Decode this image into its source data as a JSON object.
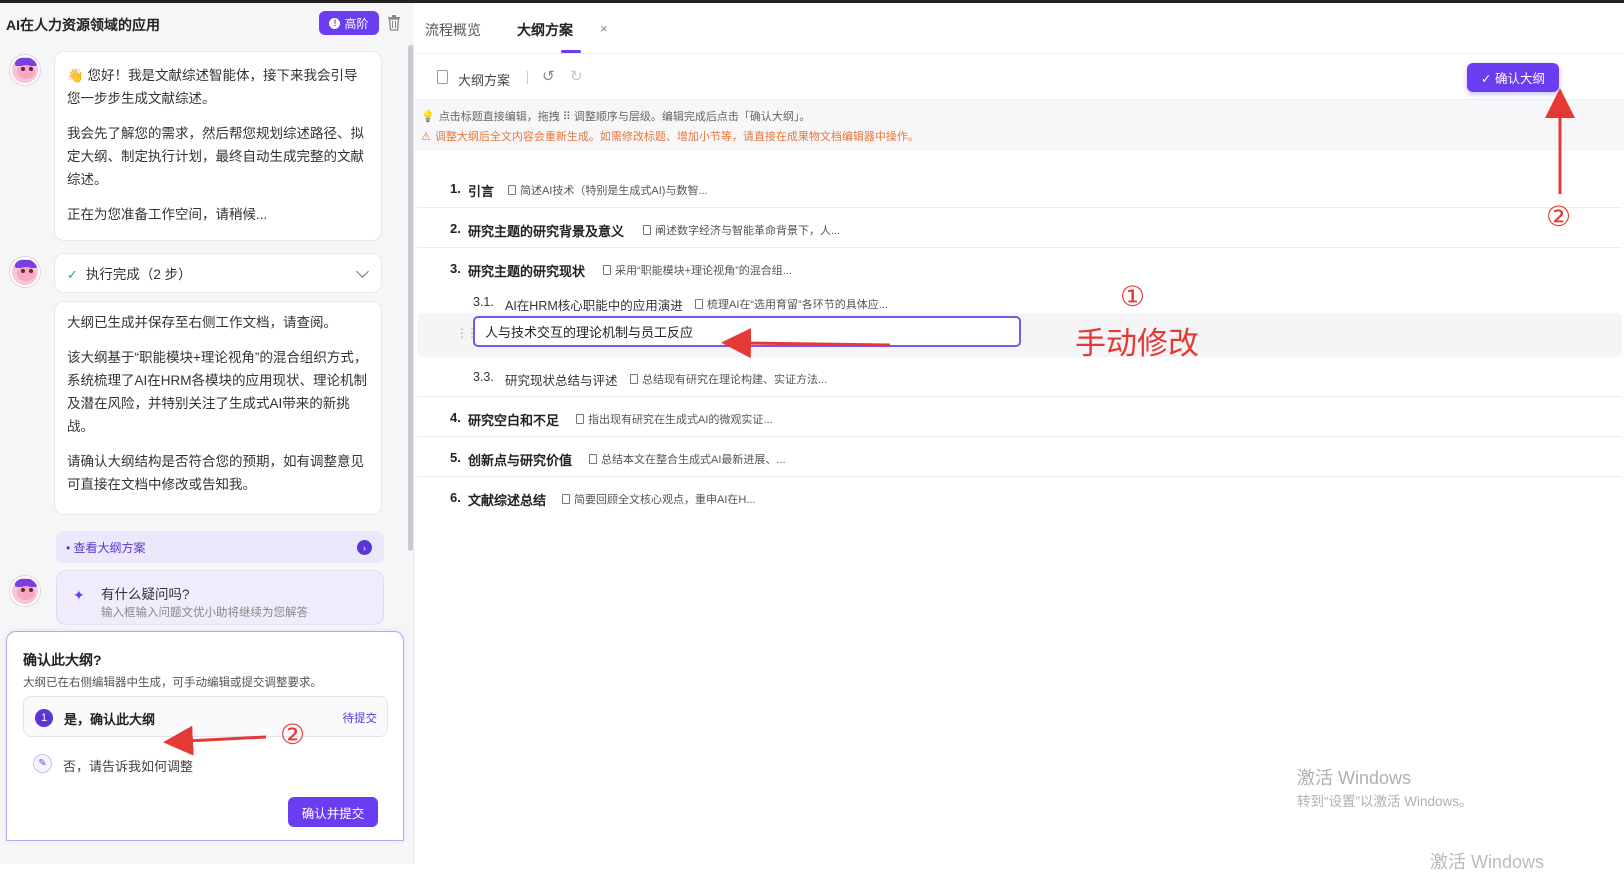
{
  "left_panel": {
    "title": "AI在人力资源领域的应用",
    "advanced_button": "高阶",
    "advanced_icon": "!",
    "messages": [
      {
        "paragraphs": [
          "👋 您好！我是文献综述智能体，接下来我会引导您一步步生成文献综述。",
          "我会先了解您的需求，然后帮您规划综述路径、拟定大纲、制定执行计划，最终自动生成完整的文献综述。",
          "正在为您准备工作空间，请稍候..."
        ]
      }
    ],
    "exec_status": "执行完成（2 步）",
    "outline_message": [
      "大纲已生成并保存至右侧工作文档，请查阅。",
      "该大纲基于“职能模块+理论视角”的混合组织方式，系统梳理了AI在HRM各模块的应用现状、理论机制及潜在风险，并特别关注了生成式AI带来的新挑战。",
      "请确认大纲结构是否符合您的预期，如有调整意见可直接在文档中修改或告知我。"
    ],
    "view_outline_link": "• 查看大纲方案",
    "question_title": "有什么疑问吗?",
    "question_sub": "输入框输入问题文优小助将继续为您解答"
  },
  "confirm_card": {
    "title": "确认此大纲?",
    "subtitle": "大纲已在右侧编辑器中生成，可手动编辑或提交调整要求。",
    "option1_num": "1",
    "option1_label": "是，确认此大纲",
    "option1_status": "待提交",
    "option2_label": "否，请告诉我如何调整",
    "submit_label": "确认并提交"
  },
  "right_panel": {
    "tabs": [
      {
        "label": "流程概览",
        "active": false
      },
      {
        "label": "大纲方案",
        "active": true
      }
    ],
    "tab_close": "×",
    "toolbar_title": "大纲方案",
    "confirm_button": "✓ 确认大纲",
    "tip": "点击标题直接编辑，拖拽 ⠿ 调整顺序与层级。编辑完成后点击「确认大纲」。",
    "warning": "调整大纲后全文内容会重新生成。如需修改标题、增加小节等，请直接在成果物文档编辑器中操作。",
    "outline": [
      {
        "num": "1.",
        "title": "引言",
        "note": "简述AI技术（特别是生成式AI)与数智..."
      },
      {
        "num": "2.",
        "title": "研究主题的研究背景及意义",
        "note": "阐述数字经济与智能革命背景下，人..."
      },
      {
        "num": "3.",
        "title": "研究主题的研究现状",
        "note": "采用“职能模块+理论视角”的混合组..."
      },
      {
        "num": "3.1.",
        "title": "AI在HRM核心职能中的应用演进",
        "note": "梳理AI在“选用育留”各环节的具体应..."
      },
      {
        "num": "",
        "title": "人与技术交互的理论机制与员工反应",
        "note": ""
      },
      {
        "num": "3.3.",
        "title": "研究现状总结与评述",
        "note": "总结现有研究在理论构建、实证方法..."
      },
      {
        "num": "4.",
        "title": "研究空白和不足",
        "note": "指出现有研究在生成式AI的微观实证..."
      },
      {
        "num": "5.",
        "title": "创新点与研究价值",
        "note": "总结本文在整合生成式AI最新进展、..."
      },
      {
        "num": "6.",
        "title": "文献综述总结",
        "note": "简要回顾全文核心观点，重申AI在H..."
      }
    ]
  },
  "annotations": {
    "circle_one": "①",
    "circle_two_top": "②",
    "circle_two_bottom": "②",
    "manual_edit": "手动修改"
  },
  "watermark": {
    "line1": "激活 Windows",
    "line2": "转到“设置”以激活 Windows。",
    "line3": "激活 Windows"
  },
  "colors": {
    "accent": "#6b3df0",
    "annotation": "#e53935",
    "warning": "#e8763a"
  }
}
